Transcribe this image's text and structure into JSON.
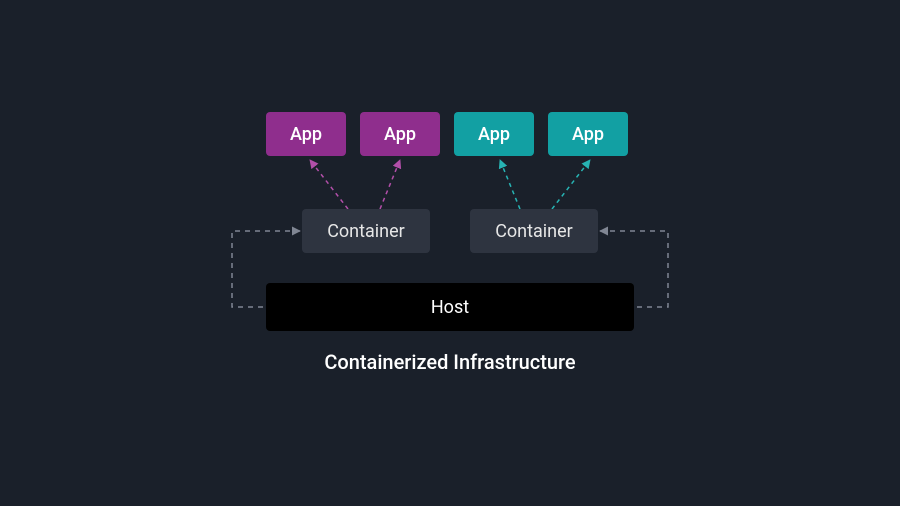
{
  "caption": "Containerized Infrastructure",
  "colors": {
    "background": "#1a202a",
    "app_purple": "#8f2e8d",
    "app_teal": "#12a0a3",
    "container": "#2e3440",
    "host": "#000000",
    "dash": "#808693",
    "dash_purple": "#b24fa9",
    "dash_teal": "#27b3b3"
  },
  "apps": [
    {
      "label": "App",
      "color": "purple"
    },
    {
      "label": "App",
      "color": "purple"
    },
    {
      "label": "App",
      "color": "teal"
    },
    {
      "label": "App",
      "color": "teal"
    }
  ],
  "containers": [
    {
      "label": "Container",
      "feeds_apps": [
        0,
        1
      ]
    },
    {
      "label": "Container",
      "feeds_apps": [
        2,
        3
      ]
    }
  ],
  "host": {
    "label": "Host"
  }
}
